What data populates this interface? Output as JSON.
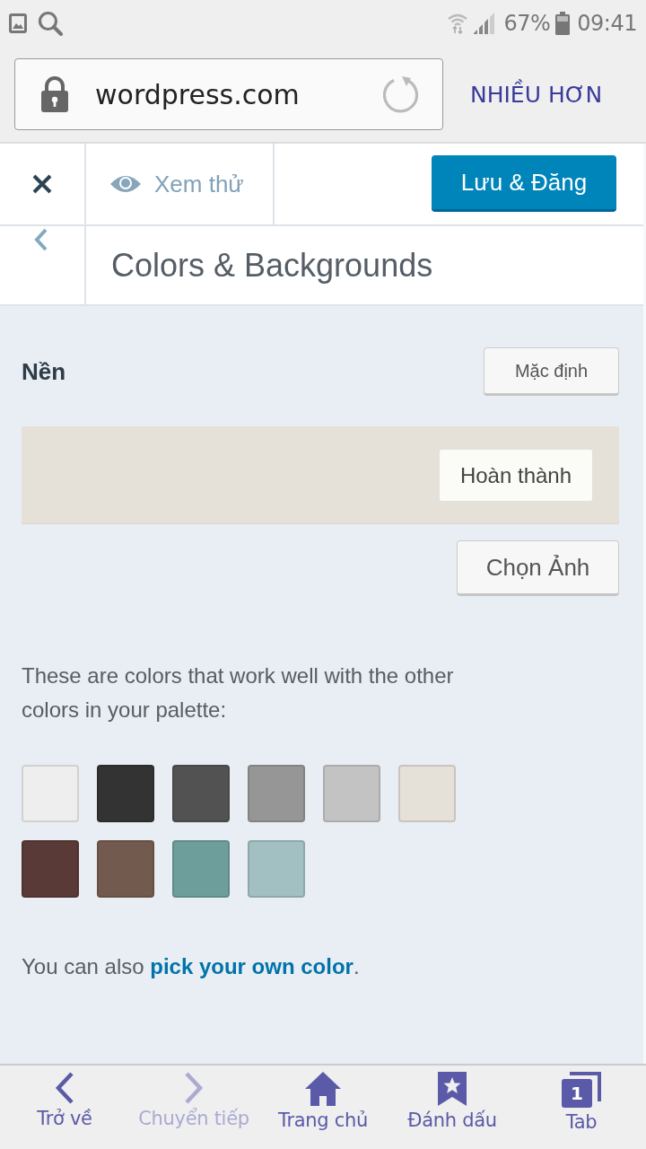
{
  "status_bar": {
    "battery": "67%",
    "time": "09:41"
  },
  "browser": {
    "url": "wordpress.com",
    "more": "NHIỀU HƠN"
  },
  "customizer": {
    "preview": "Xem thử",
    "save": "Lưu & Đăng",
    "section_title": "Colors & Backgrounds"
  },
  "background": {
    "label": "Nền",
    "default_button": "Mặc định",
    "color": "#e5e1d9",
    "done_button": "Hoàn thành",
    "choose_image_button": "Chọn Ảnh"
  },
  "palette": {
    "intro": "These are colors that work well with the other colors in your palette:",
    "swatches": [
      {
        "color": "#eeeeee"
      },
      {
        "color": "#333333"
      },
      {
        "color": "#525252"
      },
      {
        "color": "#969696"
      },
      {
        "color": "#c3c3c3"
      },
      {
        "color": "#e5e1d9"
      },
      {
        "color": "#5a3a37"
      },
      {
        "color": "#735a4f"
      },
      {
        "color": "#6e9e9c"
      },
      {
        "color": "#a2c0c2"
      }
    ],
    "note": {
      "before": "You can also ",
      "link": "pick your own color",
      "after": "."
    }
  },
  "bottom_nav": [
    {
      "kind": "back",
      "label": "Trở về",
      "disabled": false
    },
    {
      "kind": "forward",
      "label": "Chuyển tiếp",
      "disabled": true
    },
    {
      "kind": "home",
      "label": "Trang chủ",
      "disabled": false
    },
    {
      "kind": "bookmark",
      "label": "Đánh dấu",
      "disabled": false
    },
    {
      "kind": "tabs",
      "label": "Tab",
      "disabled": false,
      "count": "1"
    }
  ]
}
